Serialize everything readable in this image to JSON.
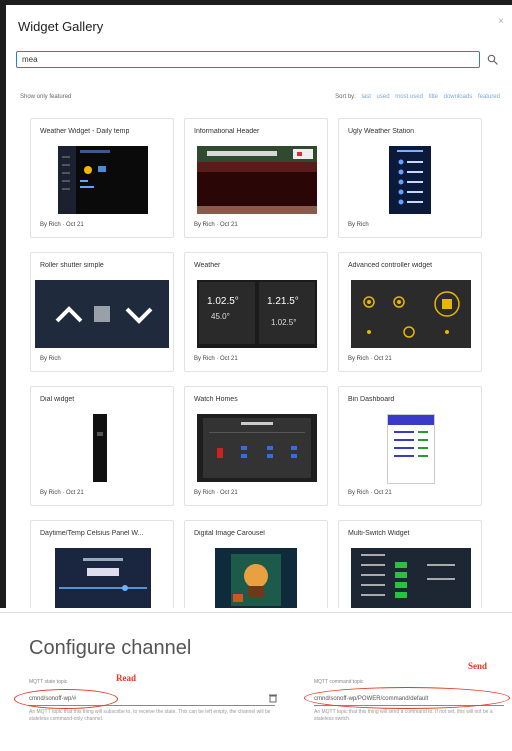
{
  "dialog": {
    "title": "Widget Gallery",
    "close_label": "×",
    "search_value": "mea",
    "show_label": "Show only featured",
    "sort_label": "Sort by:",
    "sort_options": [
      "last",
      "used",
      "most used",
      "title",
      "downloads",
      "featured"
    ]
  },
  "cards": [
    {
      "title": "Weather Widget - Daily temp",
      "footer": "By Rich · Oct 21"
    },
    {
      "title": "Informational Header",
      "footer": "By Rich · Oct 21"
    },
    {
      "title": "Ugly Weather Station",
      "footer": "By Rich"
    },
    {
      "title": "Roller shutter simple",
      "footer": "By Rich"
    },
    {
      "title": "Weather",
      "footer": "By Rich · Oct 21"
    },
    {
      "title": "Advanced controller widget",
      "footer": "By Rich · Oct 21"
    },
    {
      "title": "Dial widget",
      "footer": "By Rich · Oct 21"
    },
    {
      "title": "Watch Homes",
      "footer": "By Rich · Oct 21"
    },
    {
      "title": "Bin Dashboard",
      "footer": "By Rich · Oct 21"
    },
    {
      "title": "Daytime/Temp Celsius Panel W...",
      "footer": ""
    },
    {
      "title": "Digital Image Carousel",
      "footer": ""
    },
    {
      "title": "Multi-Switch Widget",
      "footer": ""
    }
  ],
  "weather_tiles": {
    "left_temp": "1.02.5°",
    "right_temp": "1.21.5°",
    "left_value": "45.0°",
    "right_value": "1.02.5°"
  },
  "configure": {
    "title": "Configure channel",
    "state_label": "MQTT state topic",
    "state_value": "cmnd/sonoff-wp/#",
    "read_label": "Read",
    "state_help": "An MQTT topic that this thing will subscribe to, to receive the state. This can be left empty, the channel will be stateless command-only channel.",
    "command_label": "MQTT command topic",
    "command_value": "cmnd/sonoff-wp/POWER/command/default",
    "send_label": "Send",
    "command_help": "An MQTT topic that this thing will send a command to. If not set, this will not be a stateless switch."
  },
  "colors": {
    "accent": "#2a7fd4",
    "annotation": "#e8351e"
  }
}
